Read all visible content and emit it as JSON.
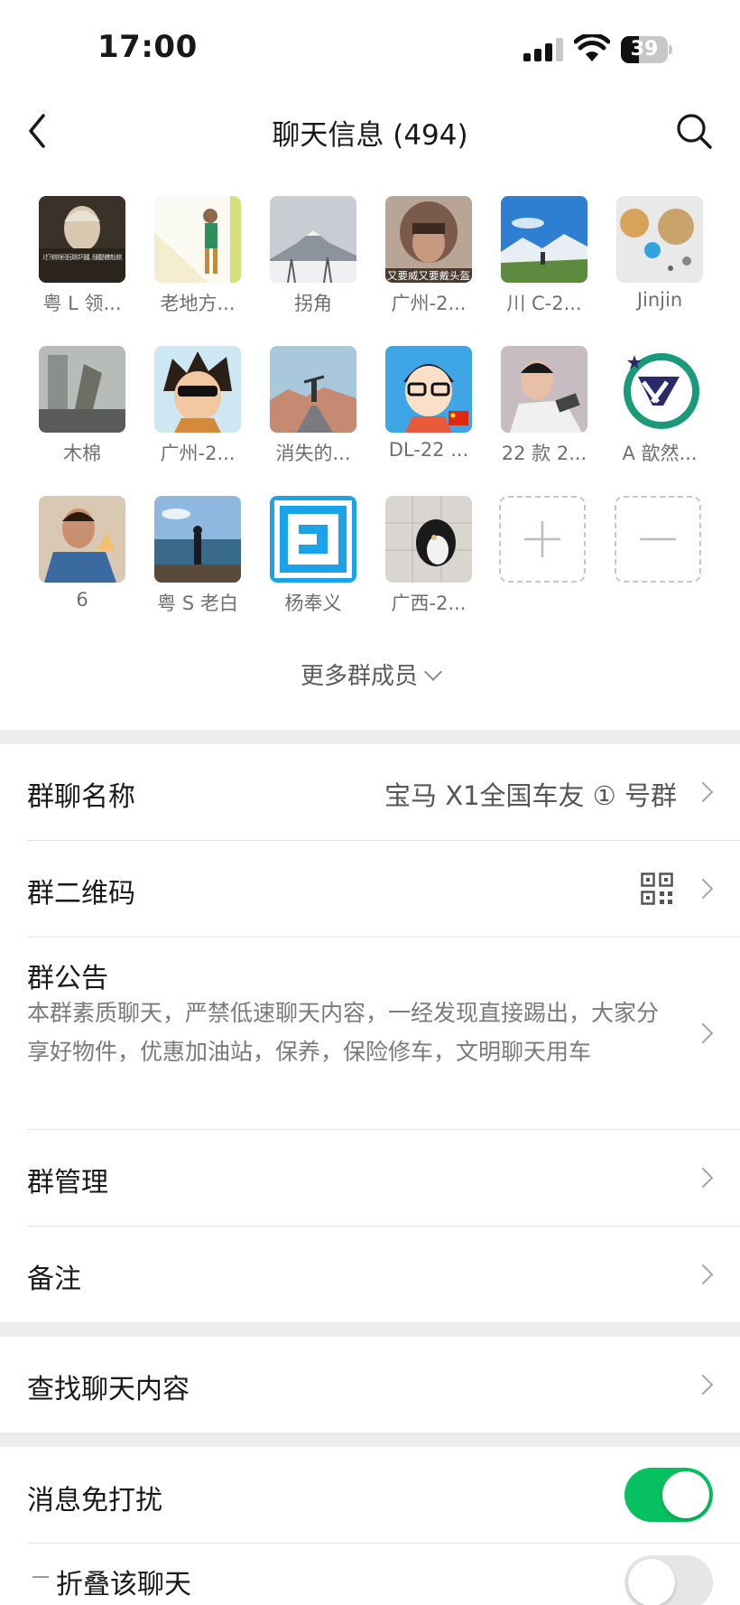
{
  "status_bar": {
    "time": "17:00",
    "battery": "39",
    "battery_level": 0.39
  },
  "nav": {
    "title": "聊天信息 (494)"
  },
  "members": [
    {
      "name": "粤 L 领..."
    },
    {
      "name": "老地方..."
    },
    {
      "name": "拐角"
    },
    {
      "name": "广州-2..."
    },
    {
      "name": "川 C-2..."
    },
    {
      "name": "Jinjin"
    },
    {
      "name": "木棉"
    },
    {
      "name": "广州-2..."
    },
    {
      "name": "消失的..."
    },
    {
      "name": "DL-22 ..."
    },
    {
      "name": "22 款 2..."
    },
    {
      "name": "A 歆然..."
    },
    {
      "name": "6"
    },
    {
      "name": "粤 S 老白"
    },
    {
      "name": "杨奉义"
    },
    {
      "name": "广西-2..."
    }
  ],
  "avatar_texts": {
    "a1": "人生下来的时候只是无知的并不愚蠢，而愚蠢是被教育出来的",
    "a4": "又要威又要戴头盔"
  },
  "more_members": "更多群成员",
  "settings": {
    "group_name_label": "群聊名称",
    "group_name_value": "宝马 X1全国车友 ① 号群",
    "qr_label": "群二维码",
    "notice_label": "群公告",
    "notice_text": "本群素质聊天，严禁低速聊天内容，一经发现直接踢出，大家分享好物件，优惠加油站，保养，保险修车，文明聊天用车",
    "manage_label": "群管理",
    "remark_label": "备注",
    "search_label": "查找聊天内容",
    "mute_label": "消息免打扰",
    "mute_on": true,
    "fold_label": "折叠该聊天",
    "fold_on": false
  },
  "colors": {
    "accent_green": "#07c160",
    "toggle_off": "#e6e6e6"
  }
}
